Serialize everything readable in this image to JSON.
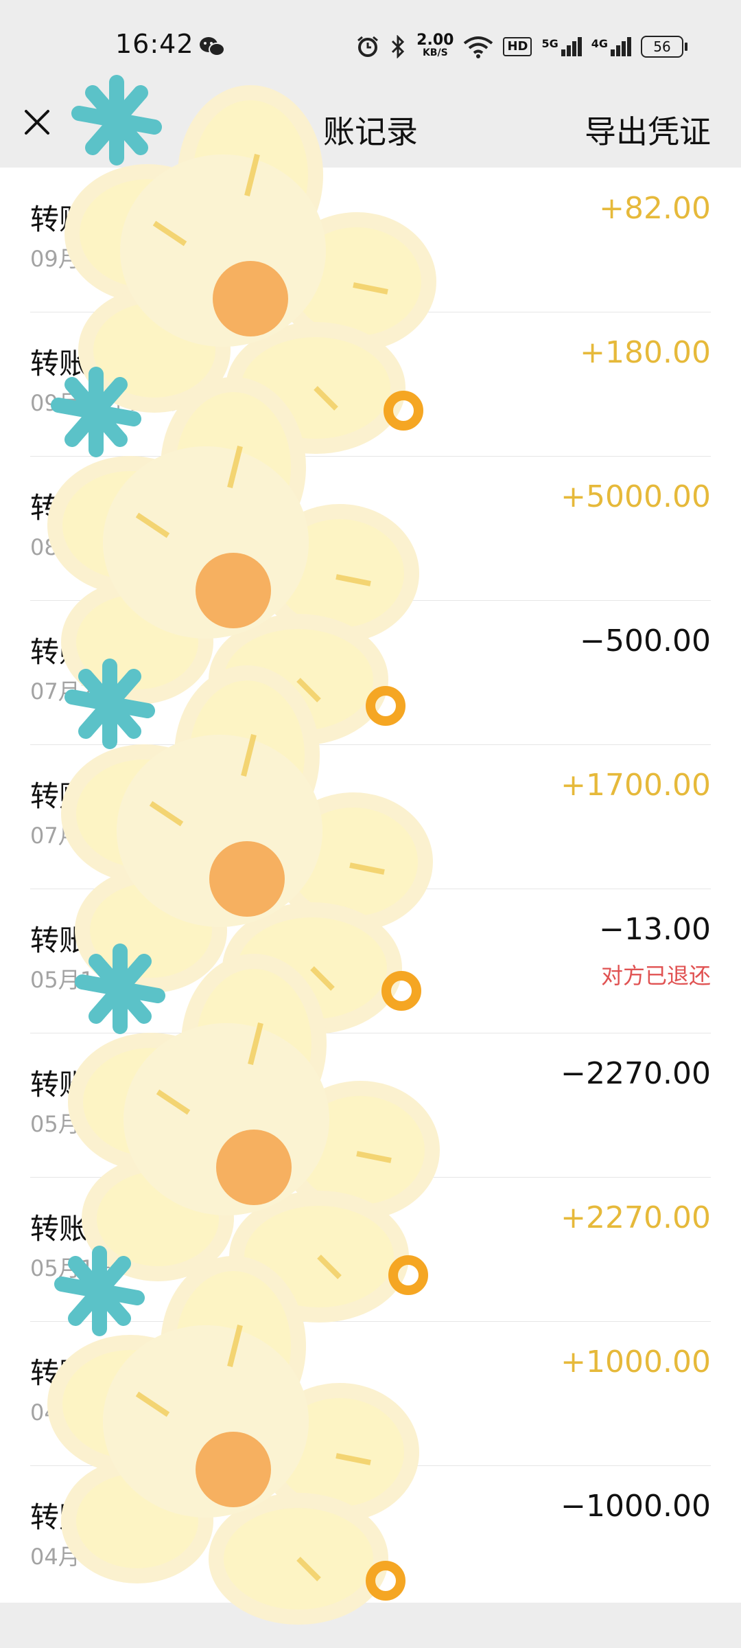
{
  "status_bar": {
    "time": "16:42",
    "network_speed": "2.00",
    "network_speed_unit": "KB/S",
    "hd_label": "HD",
    "sim1_label": "5G",
    "sim2_label": "4G",
    "battery": "56"
  },
  "header": {
    "title": "账记录",
    "export_label": "导出凭证"
  },
  "transactions": [
    {
      "title": "转账-",
      "time": "09月25",
      "amount": "+82.00",
      "type": "in"
    },
    {
      "title": "转账-来",
      "time": "09月2 日 22:32",
      "amount": "+180.00",
      "type": "in"
    },
    {
      "title": "转账",
      "time": "08月",
      "amount": "+5000.00",
      "type": "in"
    },
    {
      "title": "转账-",
      "time": "07月24",
      "amount": "−500.00",
      "type": "out"
    },
    {
      "title": "转账-",
      "time": "07月2",
      "amount": "+1700.00",
      "type": "in"
    },
    {
      "title": "转账-转",
      "time": "05月1",
      "amount": "−13.00",
      "type": "out",
      "note": "对方已退还"
    },
    {
      "title": "转账-",
      "time": "05月18",
      "amount": "−2270.00",
      "type": "out"
    },
    {
      "title": "转账-来",
      "time": "05月1 日 12:06",
      "amount": "+2270.00",
      "type": "in"
    },
    {
      "title": "转账",
      "time": "04月",
      "amount": "+1000.00",
      "type": "in"
    },
    {
      "title": "转账-",
      "time": "04月07日",
      "amount": "−1000.00",
      "type": "out"
    }
  ],
  "colors": {
    "income": "#e6b93a",
    "expense": "#111111",
    "note": "#e05252",
    "flower_petal": "#fdf0b8",
    "flower_center": "#f6b060",
    "star": "#5bc2c8"
  }
}
